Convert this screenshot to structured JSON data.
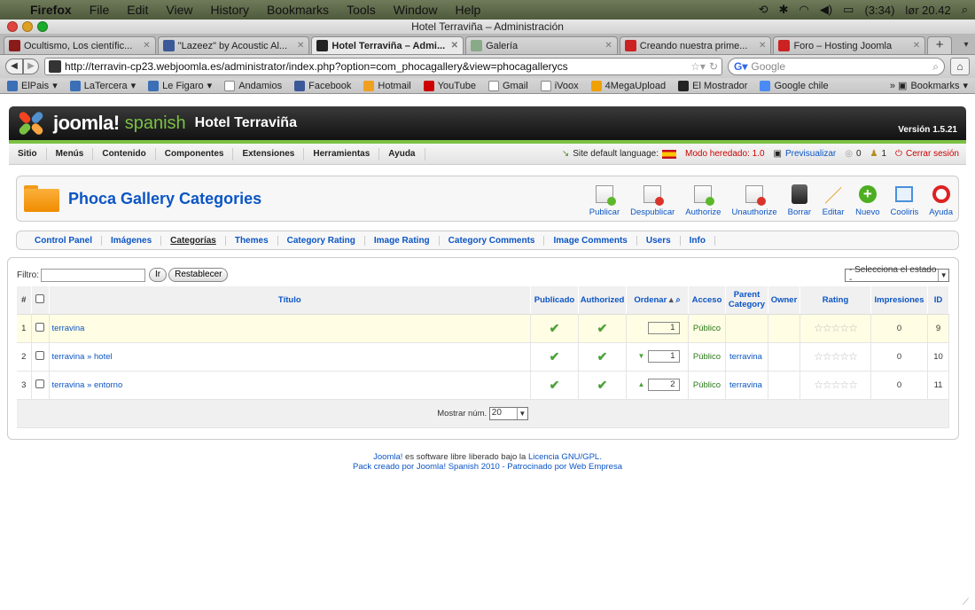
{
  "menubar": {
    "app": "Firefox",
    "items": [
      "File",
      "Edit",
      "View",
      "History",
      "Bookmarks",
      "Tools",
      "Window",
      "Help"
    ],
    "battery": "(3:34)",
    "clock": "lør 20.42"
  },
  "window": {
    "title": "Hotel Terraviña – Administración"
  },
  "tabs": [
    {
      "label": "Ocultismo, Los científic...",
      "color": "#8b1a1a",
      "active": false
    },
    {
      "label": "\"Lazeez\" by Acoustic Al...",
      "color": "#3b5998",
      "active": false
    },
    {
      "label": "Hotel Terraviña – Admi...",
      "color": "#222222",
      "active": true
    },
    {
      "label": "Galería",
      "color": "#88aa88",
      "active": false
    },
    {
      "label": "Creando nuestra prime...",
      "color": "#cc2222",
      "active": false
    },
    {
      "label": "Foro – Hosting Joomla",
      "color": "#cc2222",
      "active": false
    }
  ],
  "nav": {
    "url": "http://terravin-cp23.webjoomla.es/administrator/index.php?option=com_phocagallery&view=phocagallerycs",
    "search_placeholder": "Google"
  },
  "bookmarks": {
    "items": [
      {
        "label": "ElPais",
        "icon": "elpais-icon",
        "color": "#3b6fb6",
        "dropdown": true
      },
      {
        "label": "LaTercera",
        "icon": "latercera-icon",
        "color": "#3b6fb6",
        "dropdown": true
      },
      {
        "label": "Le Figaro",
        "icon": "lefigaro-icon",
        "color": "#3b6fb6",
        "dropdown": true
      },
      {
        "label": "Andamios",
        "icon": "page-icon",
        "color": "#ffffff",
        "dropdown": false
      },
      {
        "label": "Facebook",
        "icon": "facebook-icon",
        "color": "#3b5998",
        "dropdown": false
      },
      {
        "label": "Hotmail",
        "icon": "hotmail-icon",
        "color": "#f0a020",
        "dropdown": false
      },
      {
        "label": "YouTube",
        "icon": "youtube-icon",
        "color": "#cc0000",
        "dropdown": false
      },
      {
        "label": "Gmail",
        "icon": "page-icon",
        "color": "#ffffff",
        "dropdown": false
      },
      {
        "label": "iVoox",
        "icon": "page-icon",
        "color": "#ffffff",
        "dropdown": false
      },
      {
        "label": "4MegaUpload",
        "icon": "megaupload-icon",
        "color": "#f0a000",
        "dropdown": false
      },
      {
        "label": "El Mostrador",
        "icon": "elmostrador-icon",
        "color": "#222222",
        "dropdown": false
      },
      {
        "label": "Google chile",
        "icon": "google-icon",
        "color": "#4a8af4",
        "dropdown": false
      }
    ],
    "overflow_label": "Bookmarks"
  },
  "joomla": {
    "brand": "joomla!",
    "brand_sub": "spanish",
    "site_name": "Hotel Terraviña",
    "version": "Versión 1.5.21",
    "menu": [
      "Sitio",
      "Menús",
      "Contenido",
      "Componentes",
      "Extensiones",
      "Herramientas",
      "Ayuda"
    ],
    "status": {
      "language": "Site default language:",
      "modo": "Modo heredado: 1.0",
      "preview": "Previsualizar",
      "messages": "0",
      "users": "1",
      "logout": "Cerrar sesión"
    },
    "page_title": "Phoca Gallery Categories",
    "toolbar": [
      {
        "label": "Publicar",
        "icon": "publish-icon"
      },
      {
        "label": "Despublicar",
        "icon": "unpublish-icon"
      },
      {
        "label": "Authorize",
        "icon": "authorize-icon"
      },
      {
        "label": "Unauthorize",
        "icon": "unauthorize-icon"
      },
      {
        "label": "Borrar",
        "icon": "trash-icon"
      },
      {
        "label": "Editar",
        "icon": "edit-icon"
      },
      {
        "label": "Nuevo",
        "icon": "new-icon"
      },
      {
        "label": "Cooliris",
        "icon": "cooliris-icon"
      },
      {
        "label": "Ayuda",
        "icon": "help-icon"
      }
    ],
    "submenu": [
      {
        "label": "Control Panel",
        "active": false
      },
      {
        "label": "Imágenes",
        "active": false
      },
      {
        "label": "Categorías",
        "active": true
      },
      {
        "label": "Themes",
        "active": false
      },
      {
        "label": "Category Rating",
        "active": false
      },
      {
        "label": "Image Rating",
        "active": false
      },
      {
        "label": "Category Comments",
        "active": false
      },
      {
        "label": "Image Comments",
        "active": false
      },
      {
        "label": "Users",
        "active": false
      },
      {
        "label": "Info",
        "active": false
      }
    ],
    "filter": {
      "label": "Filtro:",
      "value": "",
      "go": "Ir",
      "reset": "Restablecer",
      "state_select": "- Selecciona el estado -"
    },
    "table": {
      "headers": {
        "num": "#",
        "title": "Título",
        "published": "Publicado",
        "authorized": "Authorized",
        "order": "Ordenar",
        "access": "Acceso",
        "parent": "Parent Category",
        "owner": "Owner",
        "rating": "Rating",
        "hits": "Impresiones",
        "id": "ID"
      },
      "rows": [
        {
          "num": "1",
          "title": "terravina",
          "order": "1",
          "access": "Público",
          "parent": "",
          "owner": "",
          "hits": "0",
          "id": "9",
          "up": false,
          "down": false,
          "highlight": true
        },
        {
          "num": "2",
          "title": "terravina » hotel",
          "order": "1",
          "access": "Público",
          "parent": "terravina",
          "owner": "",
          "hits": "0",
          "id": "10",
          "up": false,
          "down": true,
          "highlight": false
        },
        {
          "num": "3",
          "title": "terravina » entorno",
          "order": "2",
          "access": "Público",
          "parent": "terravina",
          "owner": "",
          "hits": "0",
          "id": "11",
          "up": true,
          "down": false,
          "highlight": false
        }
      ],
      "display_label": "Mostrar núm.",
      "display_value": "20"
    },
    "footer": {
      "line1_pre": "Joomla!",
      "line1_mid": " es software libre liberado bajo la ",
      "line1_link": "Licencia GNU/GPL.",
      "line2": "Pack creado por Joomla! Spanish 2010 - Patrocinado por Web Empresa"
    }
  }
}
